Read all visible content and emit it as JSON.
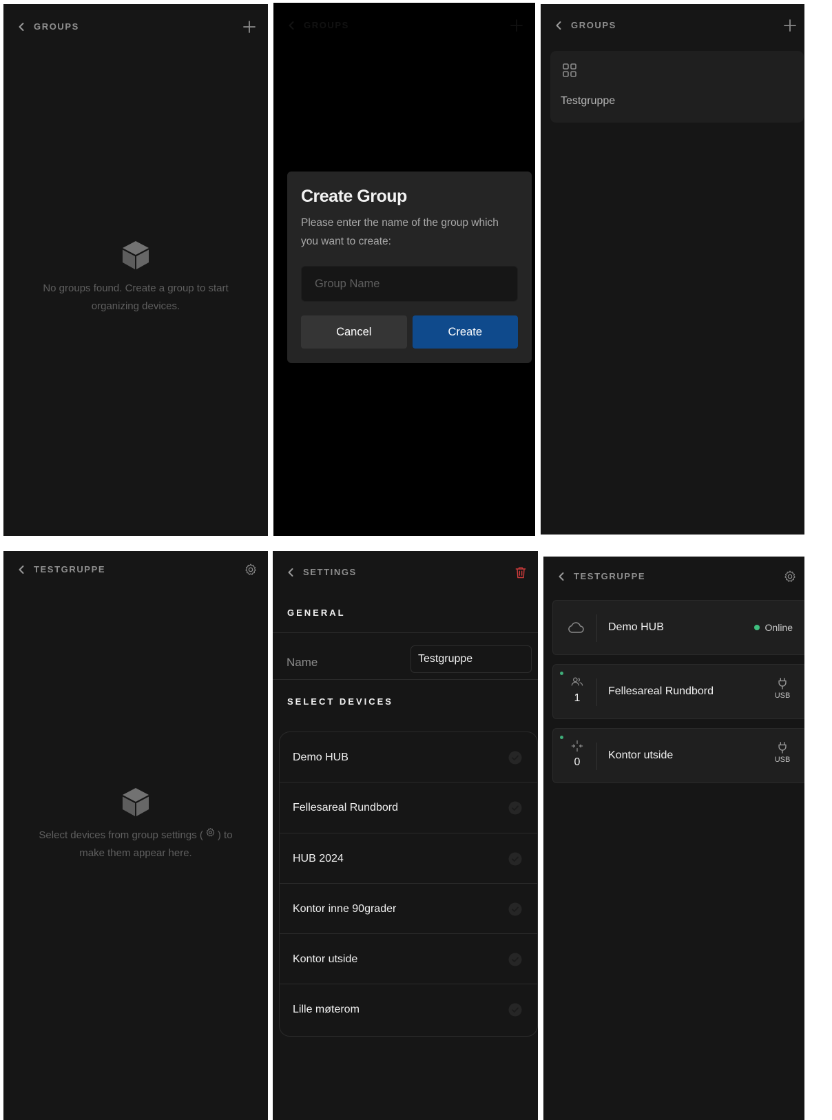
{
  "screen1": {
    "title": "GROUPS",
    "empty_message": "No groups found. Create a group to start organizing devices."
  },
  "screen2": {
    "title": "GROUPS",
    "dialog": {
      "heading": "Create Group",
      "description": "Please enter the name of the group which you want to create:",
      "placeholder": "Group Name",
      "cancel_label": "Cancel",
      "create_label": "Create"
    }
  },
  "screen3": {
    "title": "GROUPS",
    "groups": [
      {
        "name": "Testgruppe"
      }
    ]
  },
  "screen4": {
    "title": "TESTGRUPPE",
    "empty_before": "Select devices from group settings (",
    "empty_after": ") to make them appear here."
  },
  "screen5": {
    "title": "SETTINGS",
    "general_heading": "GENERAL",
    "name_label": "Name",
    "name_value": "Testgruppe",
    "select_heading": "SELECT DEVICES",
    "devices": [
      {
        "name": "Demo HUB"
      },
      {
        "name": "Fellesareal Rundbord"
      },
      {
        "name": "HUB 2024"
      },
      {
        "name": "Kontor inne 90grader"
      },
      {
        "name": "Kontor utside"
      },
      {
        "name": "Lille møterom"
      }
    ]
  },
  "screen6": {
    "title": "TESTGRUPPE",
    "hub": {
      "name": "Demo HUB",
      "status": "Online"
    },
    "devices": [
      {
        "name": "Fellesareal Rundbord",
        "count": "1",
        "power": "USB",
        "icon": "people-icon"
      },
      {
        "name": "Kontor utside",
        "count": "0",
        "power": "USB",
        "icon": "sensor-icon"
      }
    ]
  },
  "colors": {
    "background": "#161616",
    "card": "#1f1f1f",
    "accent_blue": "#0f4a8c",
    "online_green": "#3fbf7f",
    "delete_red": "#c93a3a"
  }
}
